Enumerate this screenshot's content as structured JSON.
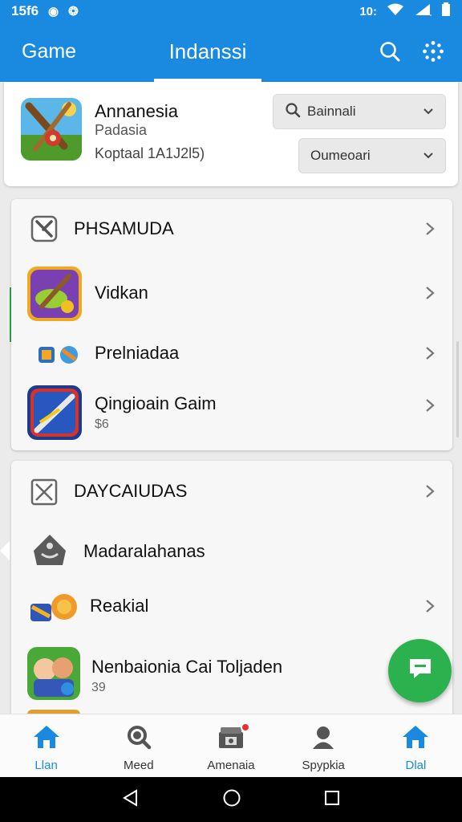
{
  "status_bar": {
    "time": "15f6",
    "left_icons": [
      "notification-icon",
      "bug-icon"
    ],
    "right_text": "10:",
    "right_icons": [
      "wifi-icon",
      "signal-icon",
      "battery-icon"
    ]
  },
  "app_bar": {
    "left_label": "Game",
    "title": "Indanssi",
    "icons": [
      "search-icon",
      "settings-icon"
    ]
  },
  "header": {
    "game_name": "Annanesia",
    "game_subtitle": "Padasia",
    "game_meta": "Koptaal 1A1J2l5)",
    "search_dropdown_label": "Bainnali",
    "sort_dropdown_label": "Oumeoari"
  },
  "section_1": {
    "title": "PHSAMUDA",
    "items": [
      {
        "label": "Vidkan",
        "sub": ""
      },
      {
        "label": "Prelniadaa",
        "sub": ""
      },
      {
        "label": "Qingioain Gaim",
        "sub": "$6"
      }
    ]
  },
  "section_2": {
    "title": "DAYCAIUDAS",
    "items": [
      {
        "label": "Madaralahanas",
        "sub": ""
      },
      {
        "label": "Reakial",
        "sub": ""
      },
      {
        "label": "Nenbaionia Cai Toljaden",
        "sub": "39"
      }
    ]
  },
  "fab": {
    "icon": "chat-icon"
  },
  "bottom_nav": [
    {
      "label": "Llan",
      "icon": "home-icon",
      "active": true
    },
    {
      "label": "Meed",
      "icon": "search-icon",
      "active": false
    },
    {
      "label": "Amenaia",
      "icon": "gift-icon",
      "active": false
    },
    {
      "label": "Spypkia",
      "icon": "profile-icon",
      "active": false
    },
    {
      "label": "Dlal",
      "icon": "home-icon",
      "active": true
    }
  ],
  "colors": {
    "primary": "#1a8ae0",
    "fab": "#2bb24e",
    "badge": "#e5322d",
    "accent_bar": "#2ba84a"
  }
}
